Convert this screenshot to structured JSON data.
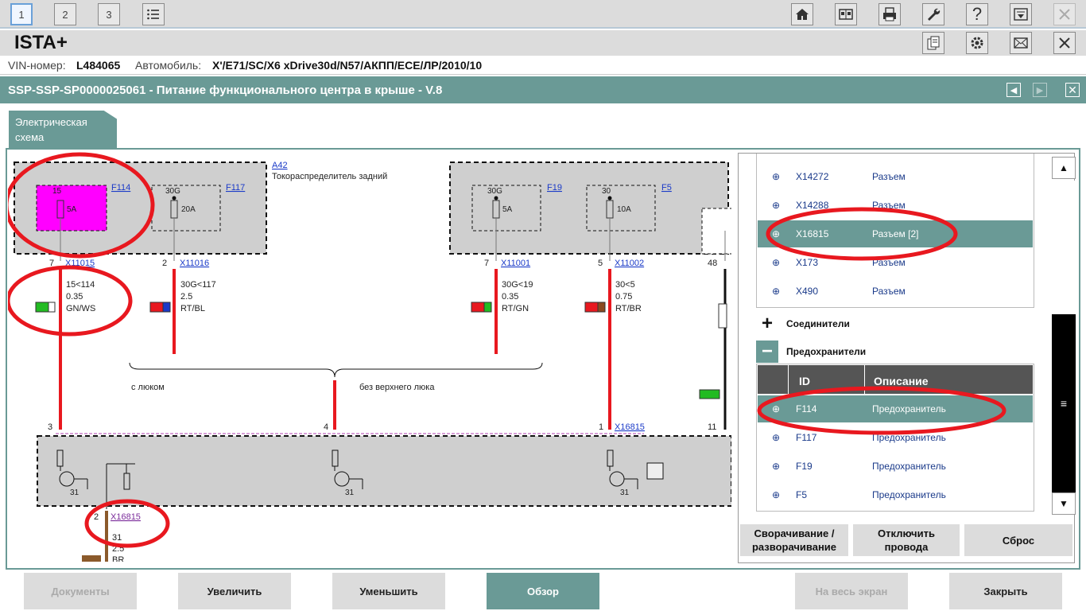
{
  "toolbar": {
    "tabs": [
      "1",
      "2",
      "3"
    ]
  },
  "app": {
    "title": "ISTA+"
  },
  "vehicle": {
    "vin_label": "VIN-номер:",
    "vin": "L484065",
    "car_label": "Автомобиль:",
    "car": "X'/E71/SC/X6 xDrive30d/N57/АКПП/ECE/ЛР/2010/10"
  },
  "document": {
    "title": "SSP-SSP-SP0000025061 - Питание функционального центра в крыше - V.8"
  },
  "tab": {
    "line1": "Электрическая",
    "line2": "схема"
  },
  "diagram": {
    "a42": "A42",
    "a42_desc": "Токораспределитель задний",
    "fuses": [
      {
        "id": "F114",
        "rating": "5A",
        "term": "15"
      },
      {
        "id": "F117",
        "rating": "20A",
        "term": "30G"
      },
      {
        "id": "F19",
        "rating": "5A",
        "term": "30G"
      },
      {
        "id": "F5",
        "rating": "10A",
        "term": "30"
      }
    ],
    "connectors": [
      {
        "pin": "7",
        "id": "X11015"
      },
      {
        "pin": "2",
        "id": "X11016"
      },
      {
        "pin": "7",
        "id": "X11001"
      },
      {
        "pin": "5",
        "id": "X11002"
      },
      {
        "pin": "48",
        "id": ""
      }
    ],
    "wires": [
      {
        "signal": "15<114",
        "size": "0.35",
        "color": "GN/WS"
      },
      {
        "signal": "30G<117",
        "size": "2.5",
        "color": "RT/BL"
      },
      {
        "signal": "30G<19",
        "size": "0.35",
        "color": "RT/GN"
      },
      {
        "signal": "30<5",
        "size": "0.75",
        "color": "RT/BR"
      }
    ],
    "variant_left": "с люком",
    "variant_right": "без верхнего люка",
    "lower_pins": [
      "3",
      "4",
      "1",
      "11"
    ],
    "lower_connector": "X16815",
    "ground": "31",
    "bottom_pin": "2",
    "bottom_connector": "X16815",
    "bottom_signal": "31",
    "bottom_size": "2.5",
    "bottom_color": "BR"
  },
  "panel": {
    "connectors": [
      {
        "id": "X14272",
        "desc": "Разъем"
      },
      {
        "id": "X14288",
        "desc": "Разъем"
      },
      {
        "id": "X16815",
        "desc": "Разъем [2]",
        "selected": true
      },
      {
        "id": "X173",
        "desc": "Разъем"
      },
      {
        "id": "X490",
        "desc": "Разъем"
      }
    ],
    "section_joints": "Соединители",
    "section_fuses": "Предохранители",
    "col_id": "ID",
    "col_desc": "Описание",
    "fuses": [
      {
        "id": "F114",
        "desc": "Предохранитель",
        "selected": true
      },
      {
        "id": "F117",
        "desc": "Предохранитель"
      },
      {
        "id": "F19",
        "desc": "Предохранитель"
      },
      {
        "id": "F5",
        "desc": "Предохранитель"
      }
    ],
    "btn_collapse_1": "Сворачивание /",
    "btn_collapse_2": "разворачивание",
    "btn_disconnect_1": "Отключить",
    "btn_disconnect_2": "провода",
    "btn_reset": "Сброс"
  },
  "bottom": {
    "docs": "Документы",
    "zoom_in": "Увеличить",
    "zoom_out": "Уменьшить",
    "overview": "Обзор",
    "fullscreen": "На весь экран",
    "close": "Закрыть"
  },
  "colors": {
    "teal": "#6a9a96",
    "highlight": "#e8181f",
    "fuse_pink": "#ff00ff"
  }
}
